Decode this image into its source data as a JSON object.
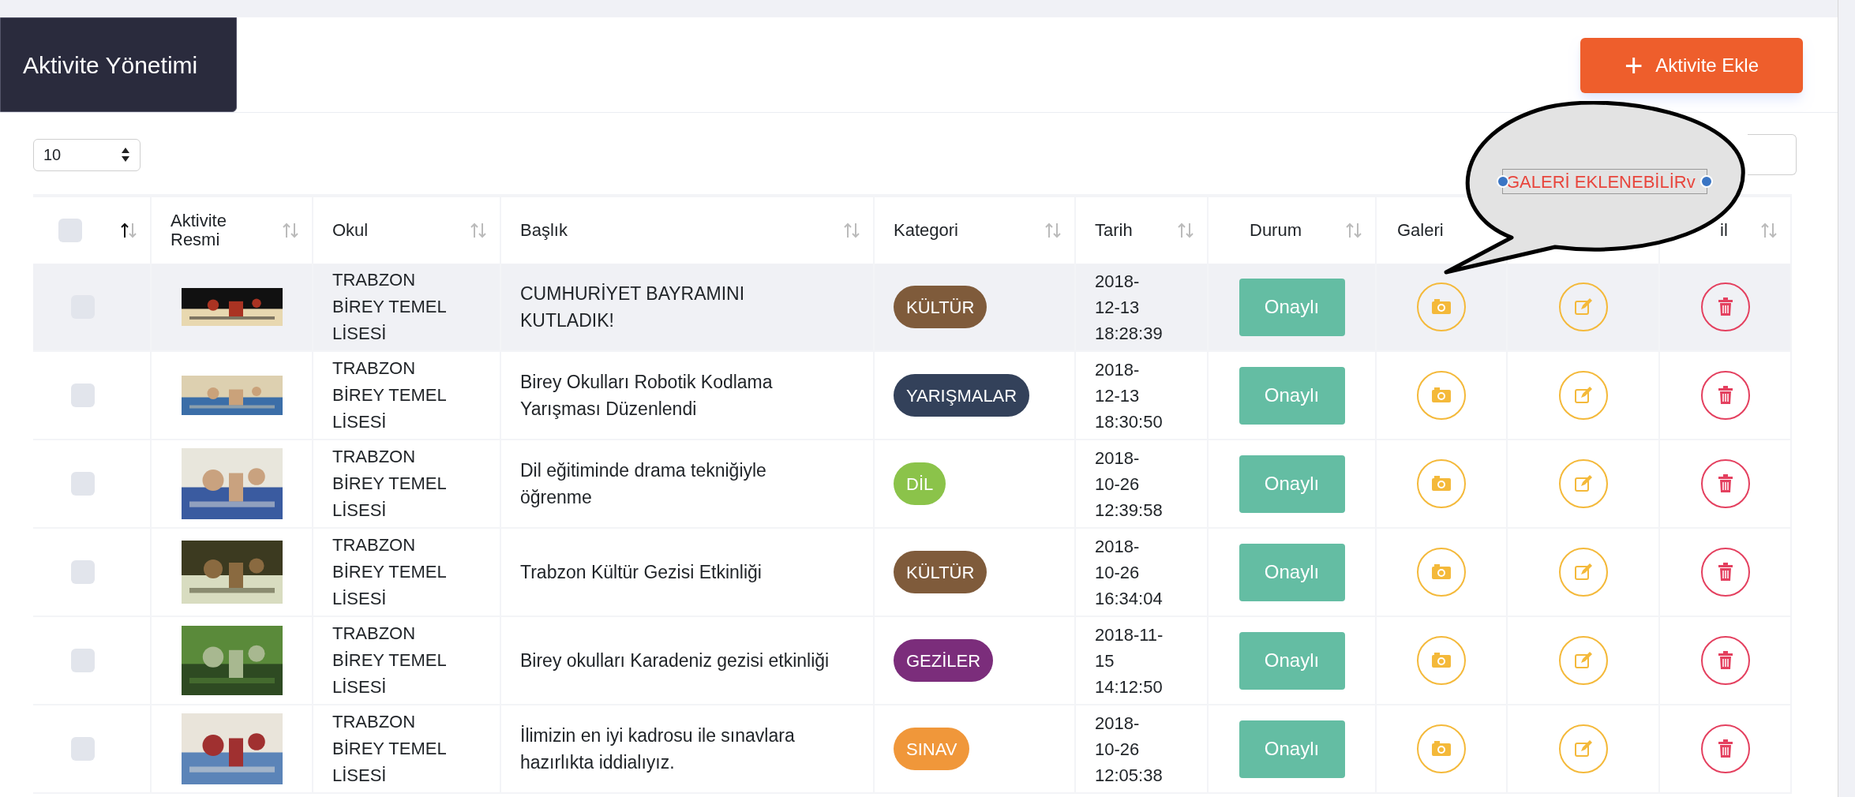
{
  "header": {
    "title": "Aktivite Yönetimi",
    "add_button": {
      "icon": "+",
      "label": "Aktivite Ekle"
    }
  },
  "page_size": {
    "value": "10"
  },
  "columns": [
    {
      "kind": "checkbox",
      "checked": false,
      "sorted": true
    },
    {
      "label": "Aktivite Resmi",
      "sorted": false
    },
    {
      "label": "Okul",
      "sorted": false
    },
    {
      "label": "Başlık",
      "sorted": false
    },
    {
      "label": "Kategori",
      "sorted": false
    },
    {
      "label": "Tarih",
      "sorted": false
    },
    {
      "label": "Durum",
      "sorted": false
    },
    {
      "label": "Galeri"
    },
    {},
    {
      "label": "il",
      "sorted": false
    }
  ],
  "rows": [
    {
      "checked": false,
      "highlighted": true,
      "school": "TRABZON BİREY TEMEL LİSESİ",
      "title": "CUMHURİYET BAYRAMINI KUTLADIK!",
      "category": {
        "label": "KÜLTÜR",
        "color": "#7f5b3b"
      },
      "date": "2018-12-13 18:28:39",
      "status": "Onaylı"
    },
    {
      "checked": false,
      "highlighted": false,
      "school": "TRABZON BİREY TEMEL LİSESİ",
      "title": "Birey Okulları Robotik Kodlama Yarışması Düzenlendi",
      "category": {
        "label": "YARIŞMALAR",
        "color": "#33415a"
      },
      "date": "2018-12-13 18:30:50",
      "status": "Onaylı"
    },
    {
      "checked": false,
      "highlighted": false,
      "school": "TRABZON BİREY TEMEL LİSESİ",
      "title": "Dil eğitiminde drama tekniğiyle öğrenme",
      "category": {
        "label": "DİL",
        "color": "#8bc34a"
      },
      "date": "2018-10-26 12:39:58",
      "status": "Onaylı"
    },
    {
      "checked": false,
      "highlighted": false,
      "school": "TRABZON BİREY TEMEL LİSESİ",
      "title": "Trabzon Kültür Gezisi Etkinliği",
      "category": {
        "label": "KÜLTÜR",
        "color": "#7f5b3b"
      },
      "date": "2018-10-26 16:34:04",
      "status": "Onaylı"
    },
    {
      "checked": false,
      "highlighted": false,
      "school": "TRABZON BİREY TEMEL LİSESİ",
      "title": "Birey okulları Karadeniz gezisi etkinliği",
      "category": {
        "label": "GEZİLER",
        "color": "#7b2d7b"
      },
      "date": "2018-11-15 14:12:50",
      "status": "Onaylı"
    },
    {
      "checked": false,
      "highlighted": false,
      "school": "TRABZON BİREY TEMEL LİSESİ",
      "title": "İlimizin en iyi kadrosu ile sınavlara hazırlıkta iddialıyız.",
      "category": {
        "label": "SINAV",
        "color": "#f0973a"
      },
      "date": "2018-10-26 12:05:38",
      "status": "Onaylı"
    }
  ],
  "callout": {
    "text": "GALERİ EKLENEBİLİRv"
  }
}
